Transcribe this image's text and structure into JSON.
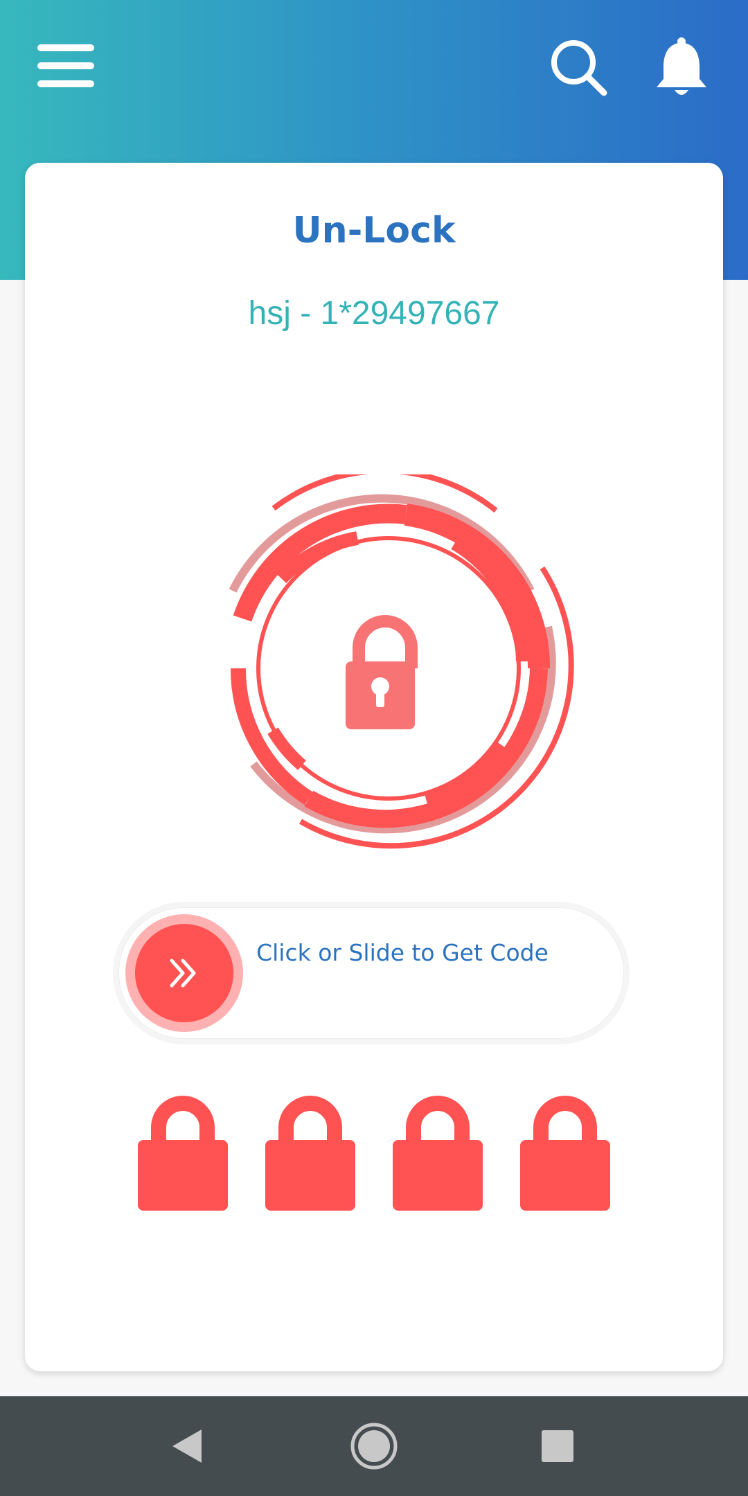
{
  "header": {
    "menu_icon": "hamburger-menu-icon",
    "search_icon": "search-icon",
    "notification_icon": "bell-icon"
  },
  "card": {
    "title": "Un-Lock",
    "device_id": "hsj - 1*29497667",
    "status_icon": "lock-icon"
  },
  "slider": {
    "label": "Click or Slide to Get Code",
    "knob_icon": "double-chevron-right-icon"
  },
  "code_locks": [
    {
      "icon": "lock-icon"
    },
    {
      "icon": "lock-icon"
    },
    {
      "icon": "lock-icon"
    },
    {
      "icon": "lock-icon"
    }
  ],
  "navbar": {
    "back_icon": "back-triangle-icon",
    "home_icon": "home-circle-icon",
    "recents_icon": "recents-square-icon"
  },
  "colors": {
    "accent_red": "#ff5252",
    "primary_blue": "#2b72bf",
    "teal": "#33b3b6"
  }
}
